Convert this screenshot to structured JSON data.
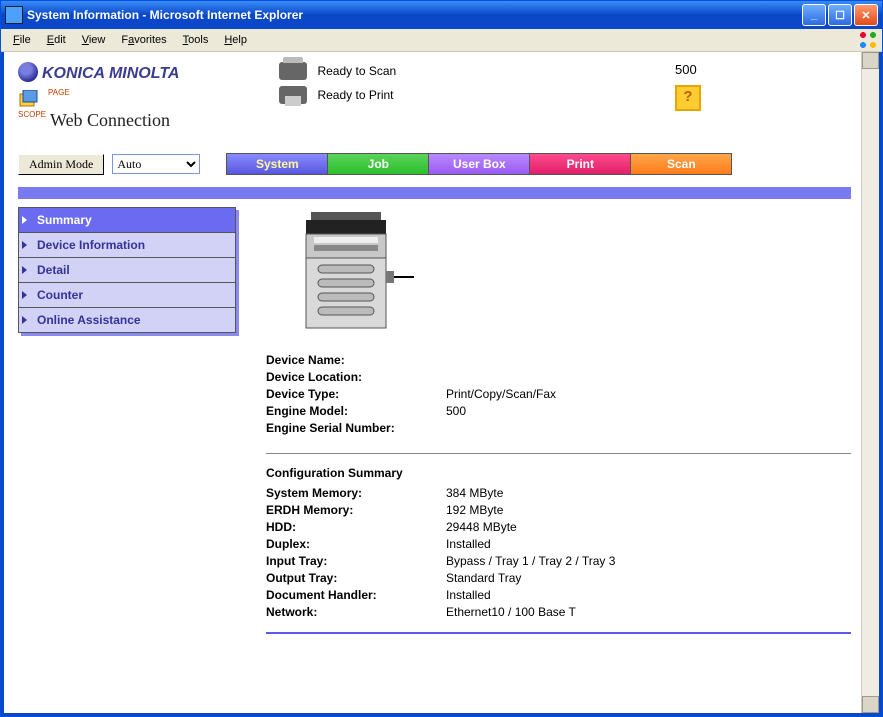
{
  "window": {
    "title": "System Information - Microsoft Internet Explorer"
  },
  "menus": [
    "File",
    "Edit",
    "View",
    "Favorites",
    "Tools",
    "Help"
  ],
  "brand": {
    "line1": "KONICA MINOLTA",
    "line2": "Web Connection"
  },
  "status": {
    "scan": "Ready to Scan",
    "print": "Ready to Print",
    "model": "500"
  },
  "mode": {
    "button": "Admin Mode",
    "select": "Auto"
  },
  "tabs": {
    "system": "System",
    "job": "Job",
    "userbox": "User Box",
    "print": "Print",
    "scan": "Scan"
  },
  "side": {
    "summary": "Summary",
    "devinfo": "Device Information",
    "detail": "Detail",
    "counter": "Counter",
    "assist": "Online Assistance"
  },
  "device": {
    "labels": {
      "name": "Device Name:",
      "loc": "Device Location:",
      "type": "Device Type:",
      "model": "Engine Model:",
      "serial": "Engine Serial Number:"
    },
    "values": {
      "name": "",
      "loc": "",
      "type": "Print/Copy/Scan/Fax",
      "model": "500",
      "serial": ""
    }
  },
  "config": {
    "heading": "Configuration Summary",
    "rows": {
      "sysmem": {
        "k": "System Memory:",
        "v": "384 MByte"
      },
      "erdh": {
        "k": "ERDH Memory:",
        "v": "192 MByte"
      },
      "hdd": {
        "k": "HDD:",
        "v": "29448 MByte"
      },
      "duplex": {
        "k": "Duplex:",
        "v": "Installed"
      },
      "intray": {
        "k": "Input Tray:",
        "v": "Bypass / Tray 1 / Tray 2 / Tray 3"
      },
      "outtray": {
        "k": "Output Tray:",
        "v": "Standard Tray"
      },
      "dochand": {
        "k": "Document Handler:",
        "v": "Installed"
      },
      "net": {
        "k": "Network:",
        "v": "Ethernet10 / 100 Base T"
      }
    }
  }
}
